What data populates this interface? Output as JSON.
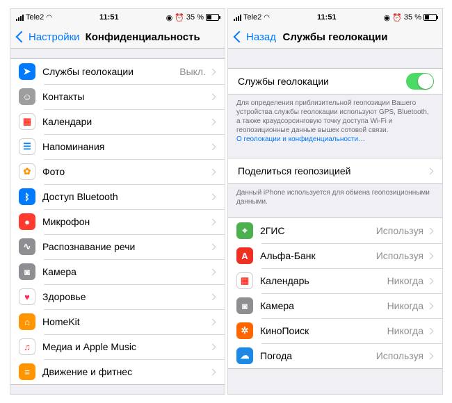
{
  "status": {
    "carrier": "Tele2",
    "time": "11:51",
    "battery": "35 %",
    "battery_level": 0.35
  },
  "left": {
    "back_label": "Настройки",
    "title": "Конфиденциальность",
    "items": [
      {
        "label": "Службы геолокации",
        "value": "Выкл.",
        "icon": "location-arrow-icon",
        "color": "#007aff"
      },
      {
        "label": "Контакты",
        "value": "",
        "icon": "contacts-icon",
        "color": "#9e9e9e"
      },
      {
        "label": "Календари",
        "value": "",
        "icon": "calendar-icon",
        "color": "#ffffff"
      },
      {
        "label": "Напоминания",
        "value": "",
        "icon": "reminders-icon",
        "color": "#ffffff"
      },
      {
        "label": "Фото",
        "value": "",
        "icon": "photos-icon",
        "color": "#ffffff"
      },
      {
        "label": "Доступ Bluetooth",
        "value": "",
        "icon": "bluetooth-icon",
        "color": "#007aff"
      },
      {
        "label": "Микрофон",
        "value": "",
        "icon": "microphone-icon",
        "color": "#ff3b30"
      },
      {
        "label": "Распознавание речи",
        "value": "",
        "icon": "speech-recognition-icon",
        "color": "#8e8e93"
      },
      {
        "label": "Камера",
        "value": "",
        "icon": "camera-icon",
        "color": "#8e8e93"
      },
      {
        "label": "Здоровье",
        "value": "",
        "icon": "health-icon",
        "color": "#ffffff"
      },
      {
        "label": "HomeKit",
        "value": "",
        "icon": "home-icon",
        "color": "#ff9500"
      },
      {
        "label": "Медиа и Apple Music",
        "value": "",
        "icon": "music-icon",
        "color": "#ffffff"
      },
      {
        "label": "Движение и фитнес",
        "value": "",
        "icon": "motion-icon",
        "color": "#ff9500"
      }
    ]
  },
  "right": {
    "back_label": "Назад",
    "title": "Службы геолокации",
    "toggle_label": "Службы геолокации",
    "toggle_on": true,
    "toggle_footer": "Для определения приблизительной геопозиции Вашего устройства службы геолокации используют GPS, Bluetooth, а также краудсорсинговую точку доступа Wi-Fi и геопозиционные данные вышек сотовой связи.",
    "toggle_link": "О геолокации и конфиденциальности…",
    "share_label": "Поделиться геопозицией",
    "share_footer": "Данный iPhone используется для обмена геопозиционными данными.",
    "apps": [
      {
        "label": "2ГИС",
        "value": "Используя",
        "icon": "2gis-icon",
        "color": "#4caf50"
      },
      {
        "label": "Альфа-Банк",
        "value": "Используя",
        "icon": "alfa-bank-icon",
        "color": "#ef3124"
      },
      {
        "label": "Календарь",
        "value": "Никогда",
        "icon": "calendar-icon",
        "color": "#ffffff"
      },
      {
        "label": "Камера",
        "value": "Никогда",
        "icon": "camera-icon",
        "color": "#8e8e93"
      },
      {
        "label": "КиноПоиск",
        "value": "Никогда",
        "icon": "kinopoisk-icon",
        "color": "#ff6600"
      },
      {
        "label": "Погода",
        "value": "Используя",
        "icon": "weather-icon",
        "color": "#1e88e5"
      }
    ]
  }
}
